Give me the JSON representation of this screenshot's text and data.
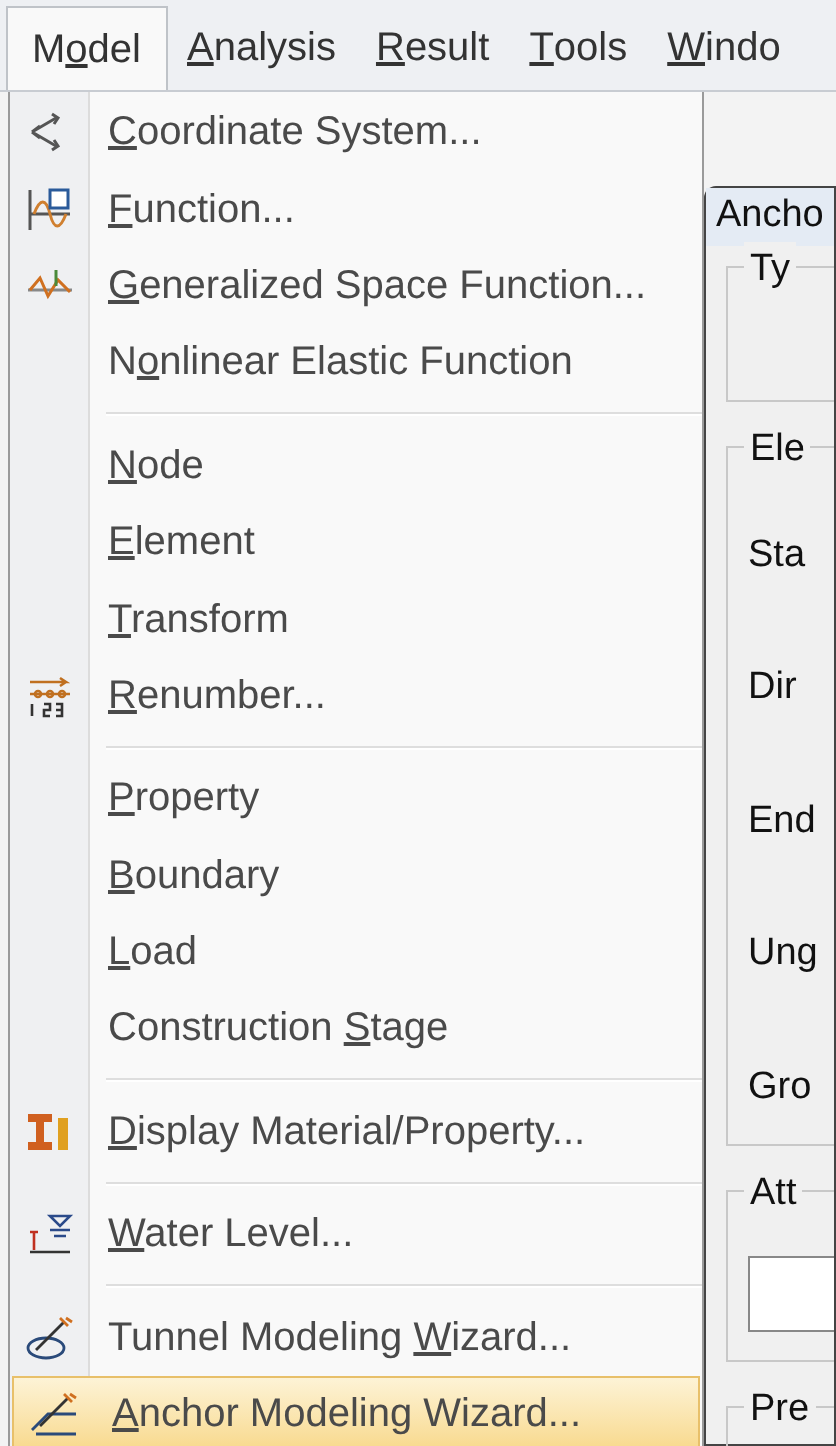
{
  "menubar": [
    {
      "pre": "M",
      "key": "o",
      "post": "del",
      "selected": true
    },
    {
      "key": "A",
      "post": "nalysis",
      "selected": false
    },
    {
      "key": "R",
      "post": "esult",
      "selected": false
    },
    {
      "key": "T",
      "post": "ools",
      "selected": false
    },
    {
      "key": "W",
      "post": "indo",
      "selected": false
    }
  ],
  "menu": [
    {
      "kind": "item",
      "key": "C",
      "post": "oordinate System...",
      "highlighted": false
    },
    {
      "kind": "item",
      "key": "F",
      "post": "unction...",
      "highlighted": false
    },
    {
      "kind": "item",
      "key": "G",
      "post": "eneralized Space Function...",
      "highlighted": false
    },
    {
      "kind": "item",
      "pre": "N",
      "key": "o",
      "post": "nlinear Elastic Function",
      "highlighted": false
    },
    {
      "kind": "separator"
    },
    {
      "kind": "item",
      "key": "N",
      "post": "ode",
      "highlighted": false
    },
    {
      "kind": "item",
      "key": "E",
      "post": "lement",
      "highlighted": false
    },
    {
      "kind": "item",
      "key": "T",
      "post": "ransform",
      "highlighted": false
    },
    {
      "kind": "item",
      "key": "R",
      "post": "enumber...",
      "highlighted": false
    },
    {
      "kind": "separator"
    },
    {
      "kind": "item",
      "key": "P",
      "post": "roperty",
      "highlighted": false
    },
    {
      "kind": "item",
      "key": "B",
      "post": "oundary",
      "highlighted": false
    },
    {
      "kind": "item",
      "key": "L",
      "post": "oad",
      "highlighted": false
    },
    {
      "kind": "item",
      "pre": "Construction ",
      "key": "S",
      "post": "tage",
      "highlighted": false
    },
    {
      "kind": "separator"
    },
    {
      "kind": "item",
      "key": "D",
      "post": "isplay Material/Property...",
      "highlighted": false
    },
    {
      "kind": "separator"
    },
    {
      "kind": "item",
      "key": "W",
      "post": "ater Level...",
      "highlighted": false
    },
    {
      "kind": "separator"
    },
    {
      "kind": "item",
      "pre": "Tunnel Modeling ",
      "key": "W",
      "post": "izard...",
      "highlighted": false
    },
    {
      "kind": "item",
      "key": "A",
      "post": "nchor Modeling Wizard...",
      "highlighted": true
    }
  ],
  "dialog": {
    "title": "Ancho",
    "groups": [
      {
        "title": "Ty",
        "field": false
      },
      {
        "title": "Ele",
        "labels": [
          "Sta",
          "Dir",
          "End",
          "Ung",
          "Gro"
        ],
        "field": false
      },
      {
        "title": "Att",
        "field": true
      },
      {
        "title": "Pre",
        "field": false
      }
    ]
  }
}
